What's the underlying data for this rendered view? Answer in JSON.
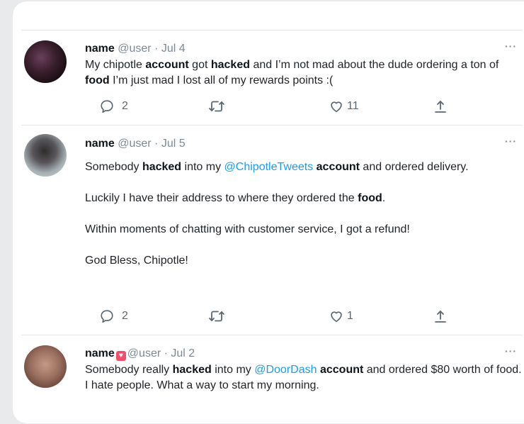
{
  "tweets": [
    {
      "name": "name",
      "handle": "@user",
      "sep": " · ",
      "date": "Jul 4",
      "more": "···",
      "segments": [
        {
          "t": "My chipotle "
        },
        {
          "t": "account",
          "b": true
        },
        {
          "t": " got "
        },
        {
          "t": "hacked",
          "b": true
        },
        {
          "t": " and I’m not mad about the dude ordering a ton of "
        },
        {
          "t": "food",
          "b": true
        },
        {
          "t": " I’m just mad I lost all of my rewards points :("
        }
      ],
      "reply_count": "2",
      "retweet_count": "",
      "like_count": "11"
    },
    {
      "name": "name",
      "handle": "@user",
      "sep": " · ",
      "date": "Jul 5",
      "more": "···",
      "paragraphs": [
        [
          {
            "t": "Somebody "
          },
          {
            "t": "hacked",
            "b": true
          },
          {
            "t": " into my "
          },
          {
            "t": "@ChipotleTweets",
            "m": true
          },
          {
            "t": " "
          },
          {
            "t": "account",
            "b": true
          },
          {
            "t": " and ordered delivery."
          }
        ],
        [
          {
            "t": "Luckily I have their address to where they ordered the "
          },
          {
            "t": "food",
            "b": true
          },
          {
            "t": "."
          }
        ],
        [
          {
            "t": "Within moments of chatting with customer service, I got a refund!"
          }
        ],
        [
          {
            "t": "God Bless, Chipotle!"
          }
        ]
      ],
      "reply_count": "2",
      "retweet_count": "",
      "like_count": "1"
    },
    {
      "name": "name",
      "handle": "@user",
      "sep": " · ",
      "date": "Jul 2",
      "more": "···",
      "badge_icon": "heart-badge-icon",
      "segments": [
        {
          "t": "Somebody really "
        },
        {
          "t": "hacked",
          "b": true
        },
        {
          "t": " into my "
        },
        {
          "t": "@DoorDash",
          "m": true
        },
        {
          "t": " "
        },
        {
          "t": "account",
          "b": true
        },
        {
          "t": " and ordered $80 worth of food. I hate people. What a way to start my morning."
        }
      ]
    }
  ],
  "icons": {
    "reply": "reply-icon",
    "retweet": "retweet-icon",
    "like": "like-icon",
    "share": "share-icon"
  },
  "colors": {
    "mention": "#1d9bf0",
    "meta": "#7d8a95",
    "background": "#e9eaeb",
    "card": "#ffffff"
  }
}
